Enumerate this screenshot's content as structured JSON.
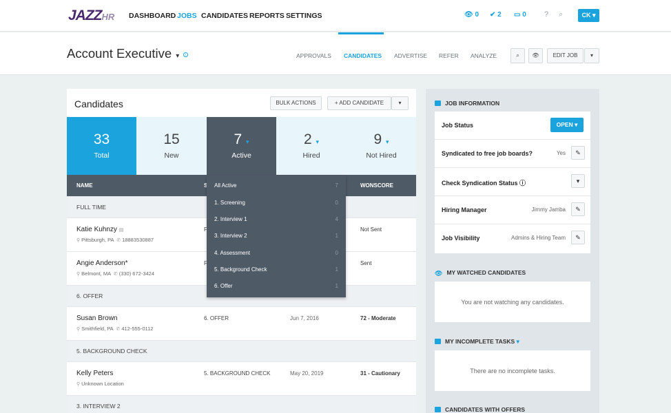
{
  "logo": {
    "main": "JAZZ",
    "sub": "HR"
  },
  "nav": {
    "items": [
      {
        "label": "DASHBOARD"
      },
      {
        "label": "JOBS"
      },
      {
        "label": "CANDIDATES"
      },
      {
        "label": "REPORTS"
      },
      {
        "label": "SETTINGS"
      }
    ],
    "stats": {
      "watching": "0",
      "tasks": "2",
      "inbox": "0"
    },
    "avatar_initials": "CK"
  },
  "job": {
    "title": "Account Executive",
    "tabs": [
      "APPROVALS",
      "CANDIDATES",
      "ADVERTISE",
      "REFER",
      "ANALYZE"
    ],
    "edit_label": "EDIT JOB"
  },
  "candidates": {
    "title": "Candidates",
    "bulk_label": "BULK ACTIONS",
    "add_label": "ADD CANDIDATE",
    "tiles": [
      {
        "num": "33",
        "label": "Total"
      },
      {
        "num": "15",
        "label": "New"
      },
      {
        "num": "7",
        "label": "Active"
      },
      {
        "num": "2",
        "label": "Hired"
      },
      {
        "num": "9",
        "label": "Not Hired"
      }
    ],
    "columns": {
      "name": "NAME",
      "stage_abbrev": "S",
      "score": "WONSCORE"
    },
    "groups": [
      "FULL TIME",
      "6. OFFER",
      "5. BACKGROUND CHECK",
      "3. INTERVIEW 2"
    ],
    "rows": [
      {
        "name": "Katie Kuhnzy",
        "location": "Pittsburgh, PA",
        "phone": "18883530887",
        "stage": "F",
        "date": "",
        "score": "Not Sent"
      },
      {
        "name": "Angie Anderson*",
        "location": "Belmont, MA",
        "phone": "(330) 672-3424",
        "stage": "F",
        "date": "",
        "score": "Sent"
      },
      {
        "name": "Susan Brown",
        "location": "Smithfield, PA",
        "phone": "412-555-0112",
        "stage": "6. OFFER",
        "date": "Jun 7, 2016",
        "score": "72 - Moderate"
      },
      {
        "name": "Kelly Peters",
        "location": "Unknown Location",
        "phone": "",
        "stage": "5. BACKGROUND CHECK",
        "date": "May 20, 2019",
        "score": "31 - Cautionary"
      }
    ]
  },
  "dropdown": {
    "items": [
      {
        "label": "All Active",
        "count": "7"
      },
      {
        "label": "1. Screening",
        "count": "0"
      },
      {
        "label": "2. Interview 1",
        "count": "4"
      },
      {
        "label": "3. Interview 2",
        "count": "1"
      },
      {
        "label": "4. Assessment",
        "count": "0"
      },
      {
        "label": "5. Background Check",
        "count": "1"
      },
      {
        "label": "6. Offer",
        "count": "1"
      }
    ]
  },
  "panel": {
    "job_info_title": "JOB INFORMATION",
    "job_status_label": "Job Status",
    "open_label": "OPEN",
    "syndicated_label": "Syndicated to free job boards?",
    "syndicated_value": "Yes",
    "check_syndication_label": "Check Syndication Status",
    "hiring_manager_label": "Hiring Manager",
    "hiring_manager_value": "Jimmy Jamba",
    "visibility_label": "Job Visibility",
    "visibility_value": "Admins & Hiring Team",
    "watched_title": "MY WATCHED CANDIDATES",
    "watched_empty": "You are not watching any candidates.",
    "tasks_title": "MY INCOMPLETE TASKS",
    "tasks_empty": "There are no incomplete tasks.",
    "offers_title": "CANDIDATES WITH OFFERS"
  },
  "colors": {
    "accent": "#1aa3dc",
    "dark": "#4f5a67",
    "light_tile": "#e8f5fb"
  }
}
